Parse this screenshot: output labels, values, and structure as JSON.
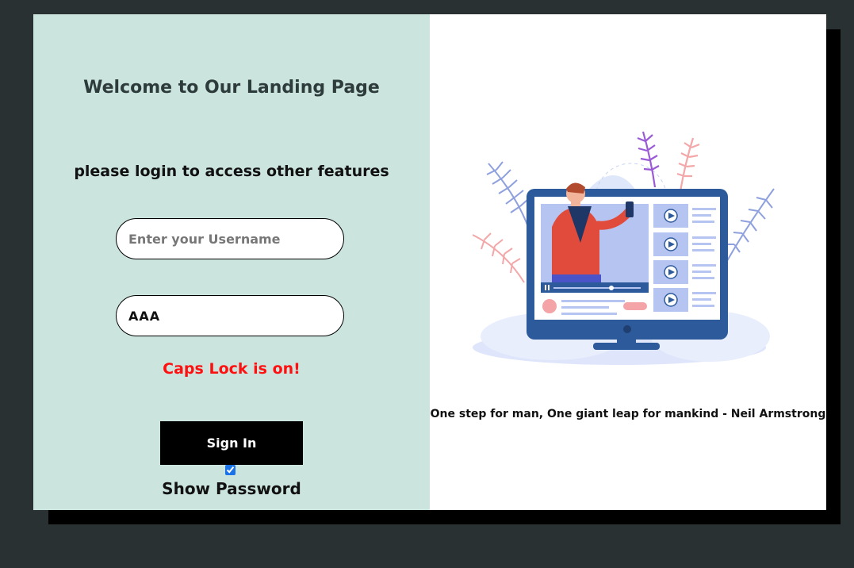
{
  "left_panel": {
    "title": "Welcome to Our Landing Page",
    "subtitle": "please login to access other features",
    "username_placeholder": "Enter your Username",
    "username_value": "",
    "password_value": "AAA",
    "caps_warning": "Caps Lock is on!",
    "signin_label": "Sign In",
    "show_password_checked": true,
    "show_password_label": "Show Password"
  },
  "right_panel": {
    "illustration": "video-streaming-monitor-illustration",
    "quote": "One step for man, One giant leap for mankind - Neil Armstrong"
  },
  "colors": {
    "page_background": "#2a3132",
    "left_panel_background": "#cbe4de",
    "warning_text": "#ff1010",
    "button_background": "#000000"
  }
}
